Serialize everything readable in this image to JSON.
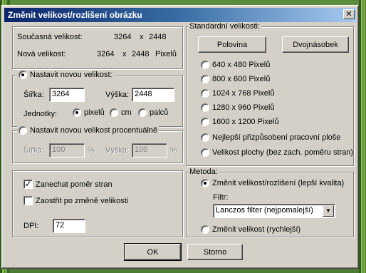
{
  "window": {
    "title": "Změnit velikost/rozlišení obrázku",
    "close_glyph": "✕"
  },
  "current": {
    "current_label": "Současná velikost:",
    "current_w": "3264",
    "x1": "x",
    "current_h": "2448",
    "new_label": "Nová velikost:",
    "new_w": "3264",
    "x2": "x",
    "new_h": "2448",
    "new_unit": "Pixelů"
  },
  "absolute": {
    "legend": "Nastavit novou velikost:",
    "width_label": "Šířka:",
    "width_value": "3264",
    "height_label": "Výška:",
    "height_value": "2448",
    "units_label": "Jednotky:",
    "units": [
      "pixelů",
      "cm",
      "palců"
    ],
    "selected_unit": "pixelů"
  },
  "percent": {
    "legend": "Nastavit novou velikost procentuálně",
    "width_label": "Šířka:",
    "width_value": "100",
    "width_unit": "%",
    "height_label": "Výška:",
    "height_value": "100",
    "height_unit": "%"
  },
  "options": {
    "keep_ratio": "Zanechat poměr stran",
    "keep_ratio_checked": "✓",
    "sharpen": "Zaostřit po změně velikosti",
    "dpi_label": "DPI:",
    "dpi_value": "72"
  },
  "standard": {
    "legend": "Standardní velikosti:",
    "half_button": "Polovina",
    "double_button": "Dvojnásobek",
    "sizes": [
      "640 x 480 Pixelů",
      "800 x 600 Pixelů",
      "1024 x 768 Pixelů",
      "1280 x 960 Pixelů",
      "1600 x 1200 Pixelů",
      "Nejlepší přizpůsobení pracovní ploše",
      "Velikost plochy (bez zach. poměru stran)"
    ]
  },
  "method": {
    "legend": "Metoda:",
    "best_quality": "Změnit velikost/rozlišení (lepší kvalita)",
    "filter_label": "Filtr:",
    "filter_value": "Lanczos filter (nejpomalejší)",
    "fast": "Změnit velikost (rychlejší)"
  },
  "buttons": {
    "ok": "OK",
    "cancel": "Storno"
  }
}
